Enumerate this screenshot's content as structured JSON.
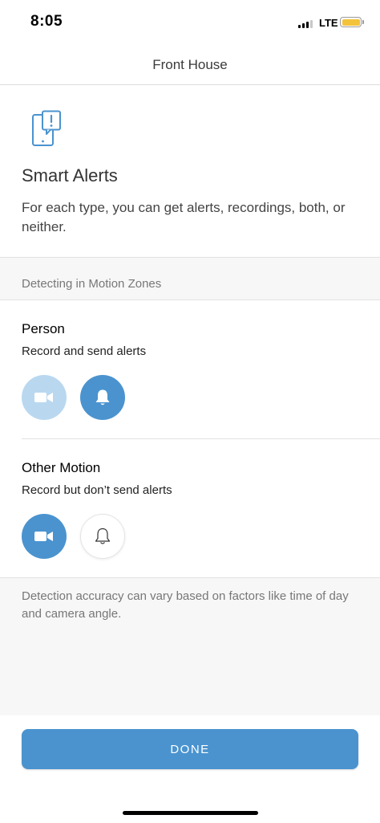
{
  "status_bar": {
    "time": "8:05",
    "network": "LTE"
  },
  "nav": {
    "title": "Front House"
  },
  "intro": {
    "icon": "smart-alert-device-icon",
    "title": "Smart Alerts",
    "description": "For each type, you can get alerts, recordings, both, or neither."
  },
  "section": {
    "header": "Detecting in Motion Zones"
  },
  "types": [
    {
      "name": "Person",
      "status": "Record and send alerts",
      "record": true,
      "alerts": true,
      "record_icon": "video-camera-icon",
      "alert_icon": "bell-icon"
    },
    {
      "name": "Other Motion",
      "status": "Record but don’t send alerts",
      "record": true,
      "alerts": false,
      "record_icon": "video-camera-icon",
      "alert_icon": "bell-icon"
    }
  ],
  "footer": {
    "note": "Detection accuracy can vary based on factors like time of day and camera angle."
  },
  "done_button": {
    "label": "DONE"
  },
  "colors": {
    "accent": "#4a93cf",
    "accent_faded": "#b9d8f0",
    "battery": "#f3c33c"
  }
}
